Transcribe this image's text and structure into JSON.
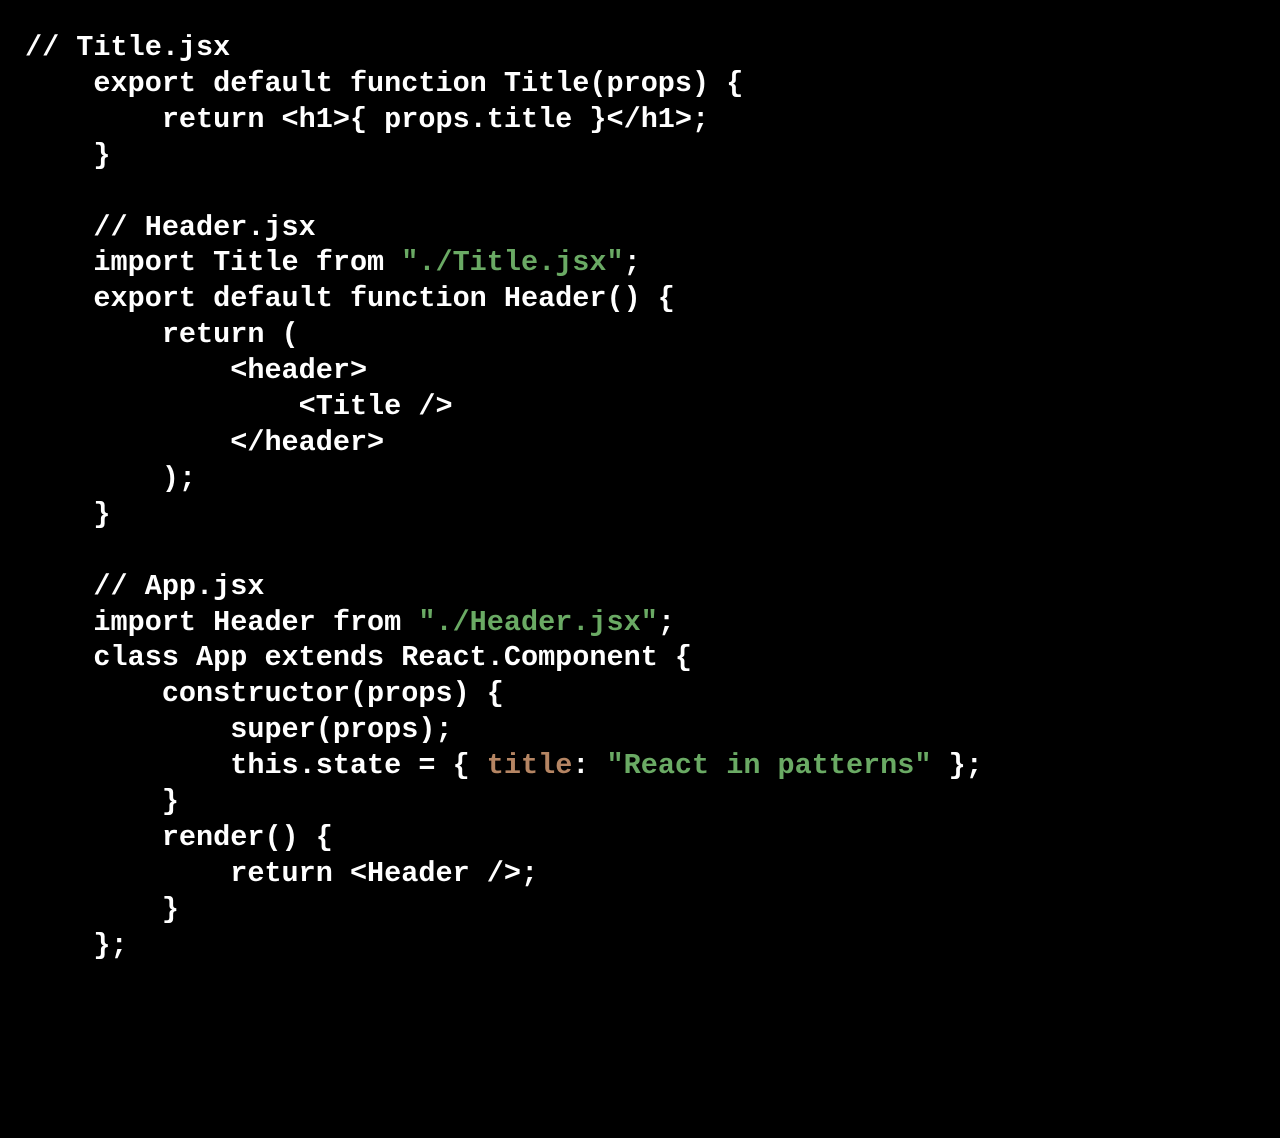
{
  "code": {
    "tokens": [
      {
        "t": "// Title.jsx\n",
        "c": ""
      },
      {
        "t": "    export default function Title(props) {\n",
        "c": ""
      },
      {
        "t": "        return <h1>{ props.title }</h1>;\n",
        "c": ""
      },
      {
        "t": "    }\n",
        "c": ""
      },
      {
        "t": "\n",
        "c": ""
      },
      {
        "t": "    // Header.jsx\n",
        "c": ""
      },
      {
        "t": "    import Title from ",
        "c": ""
      },
      {
        "t": "\"./Title.jsx\"",
        "c": "string"
      },
      {
        "t": ";\n",
        "c": ""
      },
      {
        "t": "    export default function Header() {\n",
        "c": ""
      },
      {
        "t": "        return (\n",
        "c": ""
      },
      {
        "t": "            <header>\n",
        "c": ""
      },
      {
        "t": "                <Title />\n",
        "c": ""
      },
      {
        "t": "            </header>\n",
        "c": ""
      },
      {
        "t": "        );\n",
        "c": ""
      },
      {
        "t": "    }\n",
        "c": ""
      },
      {
        "t": "\n",
        "c": ""
      },
      {
        "t": "    // App.jsx\n",
        "c": ""
      },
      {
        "t": "    import Header from ",
        "c": ""
      },
      {
        "t": "\"./Header.jsx\"",
        "c": "string"
      },
      {
        "t": ";\n",
        "c": ""
      },
      {
        "t": "    class App extends React.Component {\n",
        "c": ""
      },
      {
        "t": "        constructor(props) {\n",
        "c": ""
      },
      {
        "t": "            super(props);\n",
        "c": ""
      },
      {
        "t": "            this.state = { ",
        "c": ""
      },
      {
        "t": "title",
        "c": "keyword"
      },
      {
        "t": ": ",
        "c": ""
      },
      {
        "t": "\"React in patterns\"",
        "c": "string"
      },
      {
        "t": " };\n",
        "c": ""
      },
      {
        "t": "        }\n",
        "c": ""
      },
      {
        "t": "        render() {\n",
        "c": ""
      },
      {
        "t": "            return <Header />;\n",
        "c": ""
      },
      {
        "t": "        }\n",
        "c": ""
      },
      {
        "t": "    };\n",
        "c": ""
      }
    ]
  }
}
